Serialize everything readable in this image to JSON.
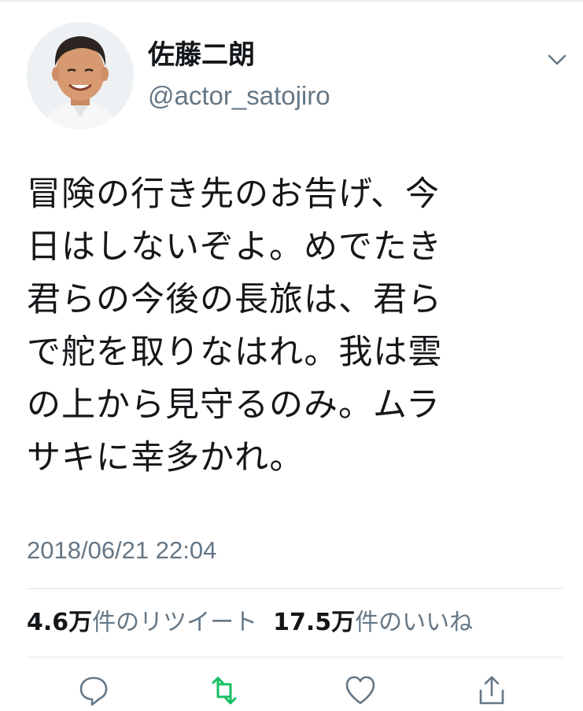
{
  "tweet": {
    "author": {
      "display_name": "佐藤二朗",
      "handle": "@actor_satojiro",
      "avatar": "avatar-photo"
    },
    "menu_icon": "chevron-down-icon",
    "text": "冒険の行き先のお告げ、今\n日はしないぞよ。めでたき\n君らの今後の長旅は、君ら\nで舵を取りなはれ。我は雲\nの上から見守るのみ。ムラ\nサキに幸多かれ。",
    "timestamp": "2018/06/21 22:04",
    "stats": {
      "retweets": {
        "count": "4.6万",
        "label": "件のリツイート"
      },
      "likes": {
        "count": "17.5万",
        "label": "件のいいね"
      }
    },
    "actions": [
      {
        "name": "reply",
        "icon": "reply-icon"
      },
      {
        "name": "retweet",
        "icon": "retweet-icon"
      },
      {
        "name": "like",
        "icon": "heart-icon"
      },
      {
        "name": "share",
        "icon": "share-icon"
      }
    ]
  },
  "colors": {
    "text_primary": "#14171a",
    "text_secondary": "#657786",
    "divider": "#e1e8ed",
    "retweet_green": "#17bf63"
  }
}
